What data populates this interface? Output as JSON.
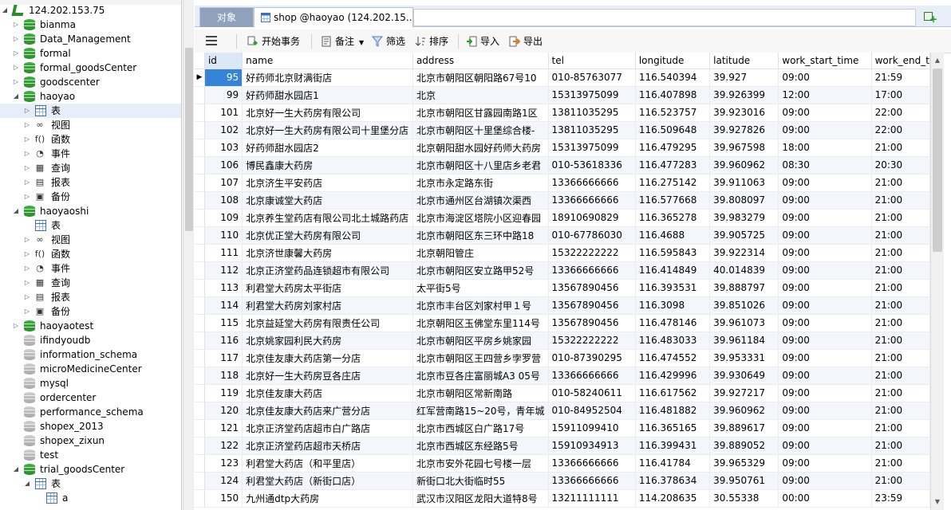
{
  "tree": {
    "connection": "124.202.153.75",
    "databases": [
      "bianma",
      "Data_Management",
      "formal",
      "formal_goodsCenter",
      "goodscenter",
      "haoyao"
    ],
    "haoyao_children": [
      "表",
      "视图",
      "函数",
      "事件",
      "查询",
      "报表",
      "备份"
    ],
    "haoyaoshi": "haoyaoshi",
    "haoyaoshi_children": [
      "表",
      "视图",
      "函数",
      "事件",
      "查询",
      "报表",
      "备份"
    ],
    "more_databases": [
      "haoyaotest",
      "ifindyoudb",
      "information_schema",
      "microMedicineCenter",
      "mysql",
      "ordercenter",
      "performance_schema",
      "shopex_2013",
      "shopex_zixun",
      "test",
      "trial_goodsCenter"
    ],
    "trial_children": [
      "表"
    ],
    "trial_table_children": [
      "a"
    ]
  },
  "tabs": {
    "objects": "对象",
    "active": "shop @haoyao (124.202.15..."
  },
  "toolbar": {
    "begin_transaction": "开始事务",
    "memo": "备注",
    "filter": "筛选",
    "sort": "排序",
    "import": "导入",
    "export": "导出"
  },
  "grid": {
    "columns": [
      "id",
      "name",
      "address",
      "tel",
      "longitude",
      "latitude",
      "work_start_time",
      "work_end_t"
    ],
    "rows": [
      [
        "95",
        "好药师北京财满街店",
        "北京市朝阳区朝阳路67号10",
        "010-85763077",
        "116.540394",
        "39.927",
        "09:00",
        "21:59"
      ],
      [
        "99",
        "好药师甜水园店1",
        "北京",
        "15313975099",
        "116.407898",
        "39.926399",
        "12:00",
        "17:00"
      ],
      [
        "101",
        "北京好一生大药房有限公司",
        "北京市朝阳区甘露园南路1区",
        "13811035295",
        "116.523757",
        "39.923016",
        "09:00",
        "22:00"
      ],
      [
        "102",
        "北京好一生大药房有限公司十里堡分店",
        "北京市朝阳区十里堡综合楼-",
        "13811035295",
        "116.509648",
        "39.927826",
        "09:00",
        "22:00"
      ],
      [
        "103",
        "好药师甜水园店2",
        "北京朝阳甜水园好药师大药房",
        "15313975099",
        "116.479295",
        "39.967598",
        "18:00",
        "21:00"
      ],
      [
        "106",
        "博民鑫康大药房",
        "北京市朝阳区十八里店乡老君",
        "010-53618336",
        "116.477283",
        "39.960962",
        "08:30",
        "20:30"
      ],
      [
        "107",
        "北京济生平安药店",
        "北京市永定路东街",
        "13366666666",
        "116.275142",
        "39.911063",
        "09:00",
        "21:00"
      ],
      [
        "108",
        "北京康诚堂大药店",
        "北京市通州区台湖镇次渠西",
        "13366666666",
        "116.577668",
        "39.808097",
        "09:00",
        "21:00"
      ],
      [
        "109",
        "北京养生堂药店有限公司北土城路药店",
        "北京市海淀区塔院小区迎春园",
        "18910690829",
        "116.365278",
        "39.983279",
        "09:00",
        "21:00"
      ],
      [
        "110",
        "北京优正堂大药房有限公司",
        "北京市朝阳区东三环中路18",
        "010-67786030",
        "116.4688",
        "39.905725",
        "09:00",
        "21:00"
      ],
      [
        "111",
        "北京济世康馨大药房",
        "北京朝阳管庄",
        "15322222222",
        "116.595843",
        "39.922314",
        "09:00",
        "21:00"
      ],
      [
        "112",
        "北京正济堂药品连锁超市有限公司",
        "北京市朝阳区安立路甲52号",
        "13366666666",
        "116.414849",
        "40.014839",
        "09:00",
        "21:00"
      ],
      [
        "113",
        "利君堂大药房太平街店",
        "太平街5号",
        "13567890456",
        "116.393531",
        "39.888797",
        "09:00",
        "21:00"
      ],
      [
        "114",
        "利君堂大药房刘家村店",
        "北京市丰台区刘家村甲１号",
        "13567890456",
        "116.3098",
        "39.851026",
        "09:00",
        "21:00"
      ],
      [
        "115",
        "北京益延堂大药房有限责任公司",
        "北京朝阳区玉佛堂东里114号",
        "13567890456",
        "116.478146",
        "39.961073",
        "09:00",
        "21:00"
      ],
      [
        "116",
        "北京姚家园利民大药房",
        "北京市朝阳区平房乡姚家园",
        "15322222222",
        "116.483033",
        "39.961184",
        "09:00",
        "21:00"
      ],
      [
        "117",
        "北京佳友康大药店第一分店",
        "北京市朝阳区王四营乡孛罗营",
        "010-87390295",
        "116.474552",
        "39.953331",
        "09:00",
        "21:00"
      ],
      [
        "118",
        "北京好一生大药房豆各庄店",
        "北京市豆各庄富丽城A3 05号",
        "13366666666",
        "116.429996",
        "39.930649",
        "09:00",
        "21:00"
      ],
      [
        "119",
        "北京佳友康大药店",
        "北京市朝阳区常新南路",
        "010-58240611",
        "116.617562",
        "39.927217",
        "09:00",
        "21:00"
      ],
      [
        "120",
        "北京佳友康大药店来广营分店",
        "红军营南路15~20号，青年城",
        "010-84952504",
        "116.481882",
        "39.960962",
        "09:00",
        "21:00"
      ],
      [
        "121",
        "北京正济堂药店超市白广路店",
        "北京市西城区白广路17号",
        "15911099410",
        "116.365165",
        "39.889617",
        "09:00",
        "21:00"
      ],
      [
        "122",
        "北京正济堂药店超市天桥店",
        "北京市西城区东经路5号",
        "15910934913",
        "116.399431",
        "39.889052",
        "09:00",
        "21:00"
      ],
      [
        "123",
        "利君堂大药店（和平里店）",
        "北京市安外花园七号楼一层",
        "13366666666",
        "116.41784",
        "39.965329",
        "09:00",
        "21:00"
      ],
      [
        "124",
        "利君堂大药店（新街口店）",
        "新街口北大街临时55",
        "13366666666",
        "116.378634",
        "39.950761",
        "09:00",
        "21:00"
      ],
      [
        "150",
        "九州通dtp大药房",
        "武汉市汉阳区龙阳大道特8号",
        "13211111111",
        "114.208635",
        "30.55338",
        "00:00",
        "23:59"
      ]
    ]
  },
  "colors": {
    "selection": "#3584d8",
    "db_icon": "#2e8b2e",
    "tab_objects_bg": "#8fa2bd"
  }
}
